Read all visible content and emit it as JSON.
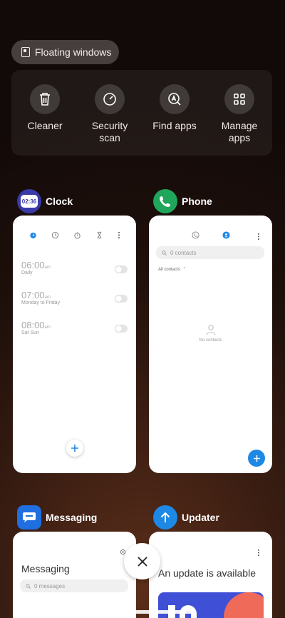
{
  "floating_windows": {
    "label": "Floating windows",
    "icon": "floating-window-icon"
  },
  "tools": [
    {
      "label": "Cleaner",
      "icon": "trash-icon"
    },
    {
      "label": "Security\nscan",
      "icon": "speedometer-icon"
    },
    {
      "label": "Find apps",
      "icon": "find-apps-icon"
    },
    {
      "label": "Manage\napps",
      "icon": "grid-icon"
    }
  ],
  "apps": {
    "clock": {
      "name": "Clock",
      "icon_time": "02:36",
      "alarms": [
        {
          "time": "06:00",
          "ampm": "am",
          "label": "Daily"
        },
        {
          "time": "07:00",
          "ampm": "am",
          "label": "Monday to Friday"
        },
        {
          "time": "08:00",
          "ampm": "am",
          "label": "Sat Sun"
        }
      ]
    },
    "phone": {
      "name": "Phone",
      "search_placeholder": "0 contacts",
      "filter_label": "All contacts",
      "empty_label": "No contacts"
    },
    "messaging": {
      "name": "Messaging",
      "title": "Messaging",
      "search_placeholder": "0 messages"
    },
    "updater": {
      "name": "Updater",
      "headline": "An update is available"
    }
  },
  "colors": {
    "clock_icon_bg": "#3a3aa8",
    "phone_icon_bg": "#1fa65a",
    "messaging_icon_bg": "#1f6fe0",
    "updater_icon_bg": "#1e88e5",
    "accent": "#1e88e5"
  }
}
